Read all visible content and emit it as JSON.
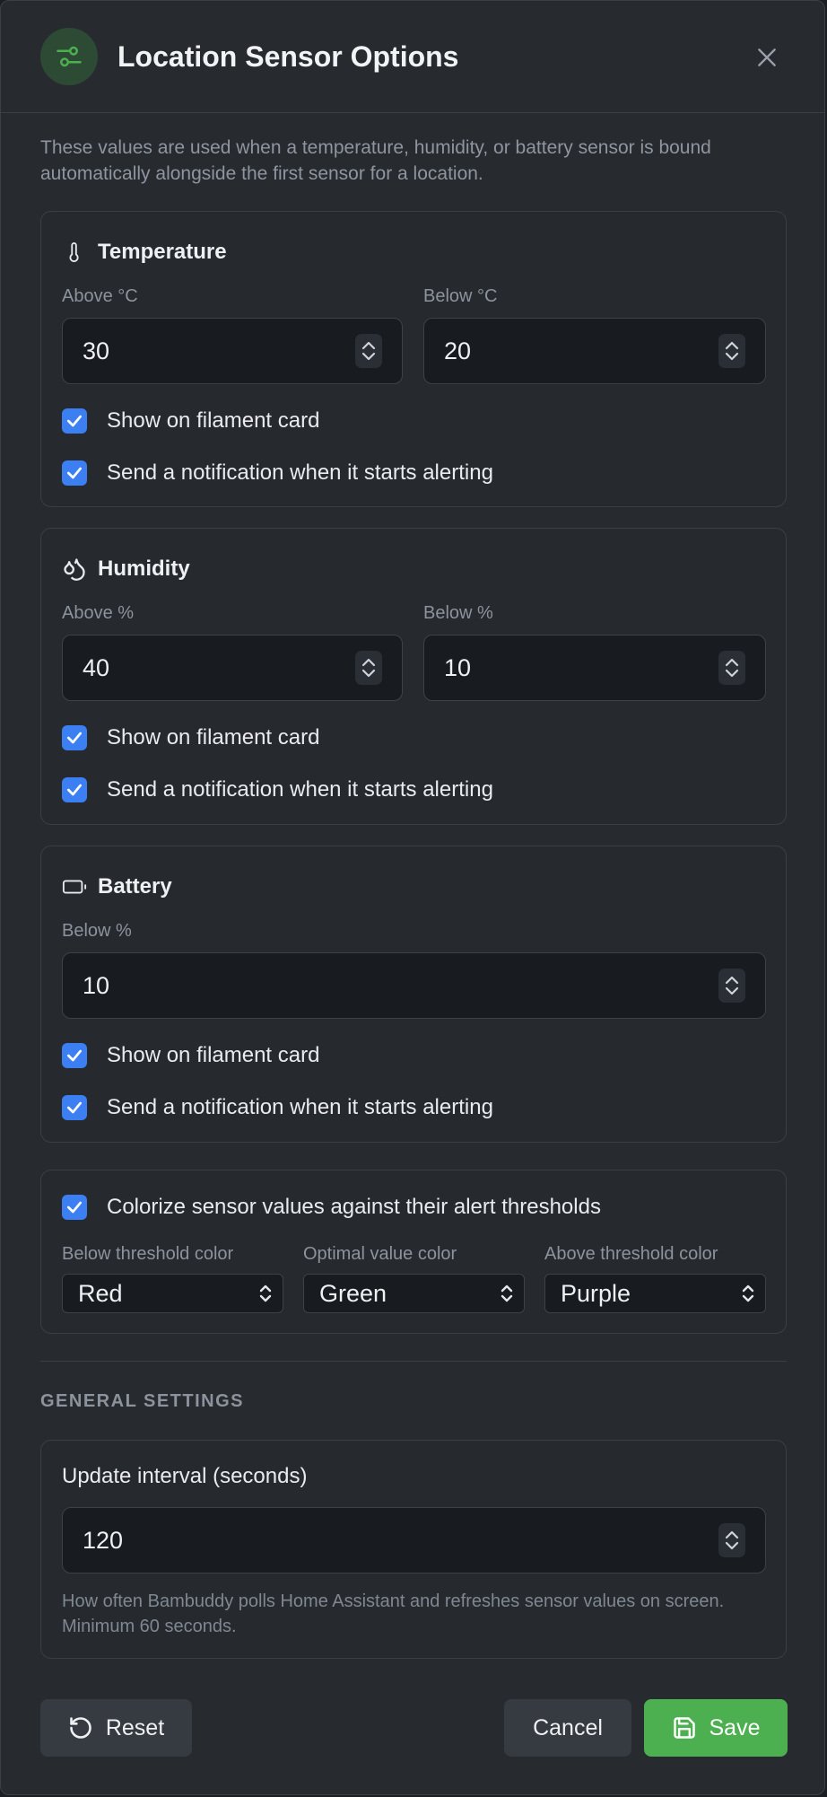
{
  "dialog": {
    "title": "Location Sensor Options",
    "description": "These values are used when a temperature, humidity, or battery sensor is bound automatically alongside the first sensor for a location."
  },
  "temperature": {
    "title": "Temperature",
    "above_label": "Above °C",
    "above_value": "30",
    "below_label": "Below °C",
    "below_value": "20",
    "show_on_card_label": "Show on filament card",
    "show_on_card_checked": true,
    "notify_label": "Send a notification when it starts alerting",
    "notify_checked": true
  },
  "humidity": {
    "title": "Humidity",
    "above_label": "Above %",
    "above_value": "40",
    "below_label": "Below %",
    "below_value": "10",
    "show_on_card_label": "Show on filament card",
    "show_on_card_checked": true,
    "notify_label": "Send a notification when it starts alerting",
    "notify_checked": true
  },
  "battery": {
    "title": "Battery",
    "below_label": "Below %",
    "below_value": "10",
    "show_on_card_label": "Show on filament card",
    "show_on_card_checked": true,
    "notify_label": "Send a notification when it starts alerting",
    "notify_checked": true
  },
  "colorize": {
    "label": "Colorize sensor values against their alert thresholds",
    "checked": true,
    "below_color_label": "Below threshold color",
    "below_color_value": "Red",
    "optimal_color_label": "Optimal value color",
    "optimal_color_value": "Green",
    "above_color_label": "Above threshold color",
    "above_color_value": "Purple"
  },
  "general": {
    "section_title": "GENERAL SETTINGS",
    "update_interval_label": "Update interval (seconds)",
    "update_interval_value": "120",
    "help_text": "How often Bambuddy polls Home Assistant and refreshes sensor values on screen. Minimum 60 seconds."
  },
  "footer": {
    "reset_label": "Reset",
    "cancel_label": "Cancel",
    "save_label": "Save"
  },
  "icons": {
    "header": "sliders-icon",
    "close": "close-icon",
    "temperature": "thermometer-icon",
    "humidity": "droplets-icon",
    "battery": "battery-icon",
    "reset": "rotate-ccw-icon",
    "save": "save-icon"
  },
  "colors": {
    "accent": "#4caf50",
    "checkbox": "#3b7ff2",
    "background": "#272b30"
  }
}
